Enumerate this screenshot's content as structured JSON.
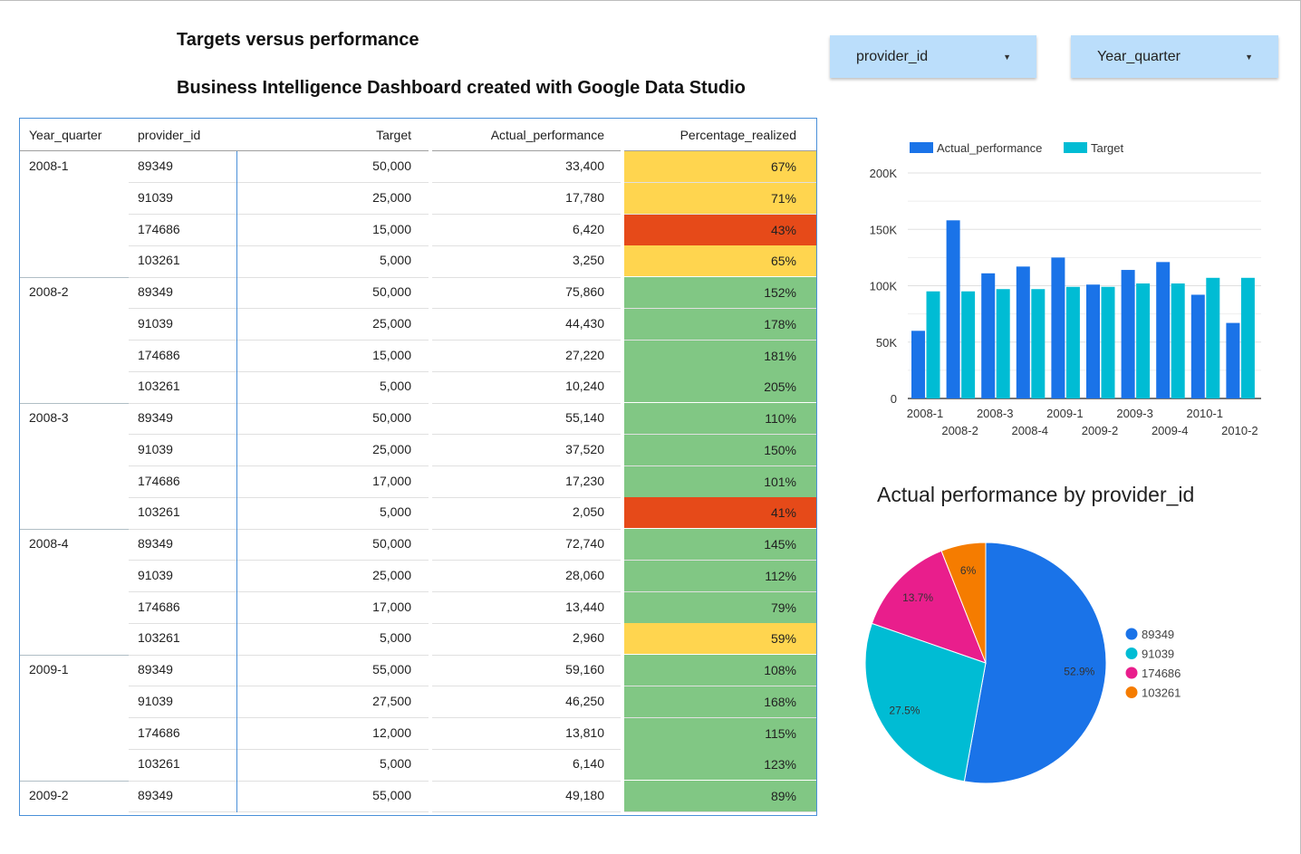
{
  "header": {
    "title": "Targets versus performance",
    "subtitle": "Business Intelligence Dashboard created with Google Data Studio"
  },
  "filters": [
    {
      "label": "provider_id"
    },
    {
      "label": "Year_quarter"
    }
  ],
  "table": {
    "columns": [
      "Year_quarter",
      "provider_id",
      "Target",
      "Actual_performance",
      "Percentage_realized"
    ],
    "groups": [
      {
        "quarter": "2008-1",
        "rows": [
          {
            "provider": "89349",
            "target": "50,000",
            "actual": "33,400",
            "pct": "67%",
            "color": "#ffd54f"
          },
          {
            "provider": "91039",
            "target": "25,000",
            "actual": "17,780",
            "pct": "71%",
            "color": "#ffd54f"
          },
          {
            "provider": "174686",
            "target": "15,000",
            "actual": "6,420",
            "pct": "43%",
            "color": "#e64a19"
          },
          {
            "provider": "103261",
            "target": "5,000",
            "actual": "3,250",
            "pct": "65%",
            "color": "#ffd54f"
          }
        ]
      },
      {
        "quarter": "2008-2",
        "rows": [
          {
            "provider": "89349",
            "target": "50,000",
            "actual": "75,860",
            "pct": "152%",
            "color": "#81c784"
          },
          {
            "provider": "91039",
            "target": "25,000",
            "actual": "44,430",
            "pct": "178%",
            "color": "#81c784"
          },
          {
            "provider": "174686",
            "target": "15,000",
            "actual": "27,220",
            "pct": "181%",
            "color": "#81c784"
          },
          {
            "provider": "103261",
            "target": "5,000",
            "actual": "10,240",
            "pct": "205%",
            "color": "#81c784"
          }
        ]
      },
      {
        "quarter": "2008-3",
        "rows": [
          {
            "provider": "89349",
            "target": "50,000",
            "actual": "55,140",
            "pct": "110%",
            "color": "#81c784"
          },
          {
            "provider": "91039",
            "target": "25,000",
            "actual": "37,520",
            "pct": "150%",
            "color": "#81c784"
          },
          {
            "provider": "174686",
            "target": "17,000",
            "actual": "17,230",
            "pct": "101%",
            "color": "#81c784"
          },
          {
            "provider": "103261",
            "target": "5,000",
            "actual": "2,050",
            "pct": "41%",
            "color": "#e64a19"
          }
        ]
      },
      {
        "quarter": "2008-4",
        "rows": [
          {
            "provider": "89349",
            "target": "50,000",
            "actual": "72,740",
            "pct": "145%",
            "color": "#81c784"
          },
          {
            "provider": "91039",
            "target": "25,000",
            "actual": "28,060",
            "pct": "112%",
            "color": "#81c784"
          },
          {
            "provider": "174686",
            "target": "17,000",
            "actual": "13,440",
            "pct": "79%",
            "color": "#81c784"
          },
          {
            "provider": "103261",
            "target": "5,000",
            "actual": "2,960",
            "pct": "59%",
            "color": "#ffd54f"
          }
        ]
      },
      {
        "quarter": "2009-1",
        "rows": [
          {
            "provider": "89349",
            "target": "55,000",
            "actual": "59,160",
            "pct": "108%",
            "color": "#81c784"
          },
          {
            "provider": "91039",
            "target": "27,500",
            "actual": "46,250",
            "pct": "168%",
            "color": "#81c784"
          },
          {
            "provider": "174686",
            "target": "12,000",
            "actual": "13,810",
            "pct": "115%",
            "color": "#81c784"
          },
          {
            "provider": "103261",
            "target": "5,000",
            "actual": "6,140",
            "pct": "123%",
            "color": "#81c784"
          }
        ]
      },
      {
        "quarter": "2009-2",
        "rows": [
          {
            "provider": "89349",
            "target": "55,000",
            "actual": "49,180",
            "pct": "89%",
            "color": "#81c784"
          }
        ]
      }
    ]
  },
  "chart_data": [
    {
      "type": "bar",
      "title": "",
      "xlabel": "",
      "ylabel": "",
      "legend_position": "top-left",
      "grid": true,
      "categories": [
        "2008-1",
        "2008-2",
        "2008-3",
        "2008-4",
        "2009-1",
        "2009-2",
        "2009-3",
        "2009-4",
        "2010-1",
        "2010-2"
      ],
      "series": [
        {
          "name": "Actual_performance",
          "color": "#1a73e8",
          "values": [
            60000,
            158000,
            111000,
            117000,
            125000,
            101000,
            114000,
            121000,
            92000,
            67000
          ]
        },
        {
          "name": "Target",
          "color": "#00bcd4",
          "values": [
            95000,
            95000,
            97000,
            97000,
            99000,
            99000,
            102000,
            102000,
            107000,
            107000
          ]
        }
      ],
      "ylim": [
        0,
        200000
      ],
      "yticks": [
        "0",
        "50K",
        "100K",
        "150K",
        "200K"
      ]
    },
    {
      "type": "pie",
      "title": "Actual performance by provider_id",
      "legend_position": "right",
      "slices": [
        {
          "label": "89349",
          "value": 52.9,
          "text": "52.9%",
          "color": "#1a73e8"
        },
        {
          "label": "91039",
          "value": 27.5,
          "text": "27.5%",
          "color": "#00bcd4"
        },
        {
          "label": "174686",
          "value": 13.7,
          "text": "13.7%",
          "color": "#e91e8c"
        },
        {
          "label": "103261",
          "value": 6.0,
          "text": "6%",
          "color": "#f57c00"
        }
      ]
    }
  ]
}
